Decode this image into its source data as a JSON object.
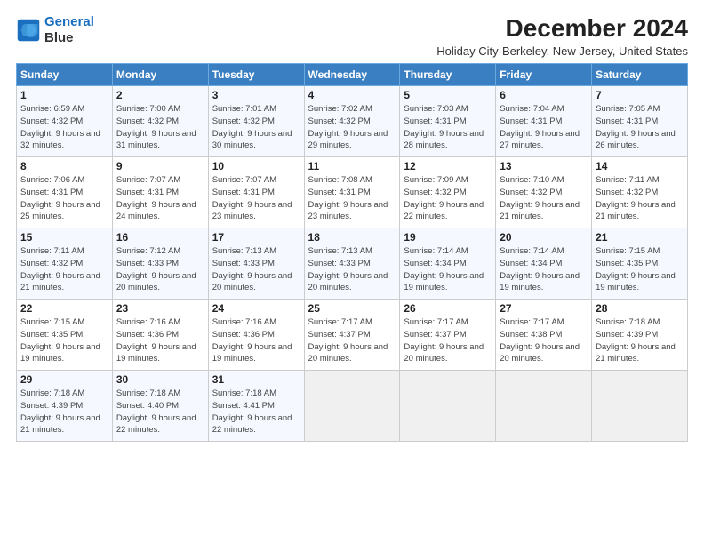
{
  "header": {
    "logo_line1": "General",
    "logo_line2": "Blue",
    "month_title": "December 2024",
    "location": "Holiday City-Berkeley, New Jersey, United States"
  },
  "weekdays": [
    "Sunday",
    "Monday",
    "Tuesday",
    "Wednesday",
    "Thursday",
    "Friday",
    "Saturday"
  ],
  "weeks": [
    [
      {
        "day": "1",
        "sunrise": "6:59 AM",
        "sunset": "4:32 PM",
        "daylight": "9 hours and 32 minutes."
      },
      {
        "day": "2",
        "sunrise": "7:00 AM",
        "sunset": "4:32 PM",
        "daylight": "9 hours and 31 minutes."
      },
      {
        "day": "3",
        "sunrise": "7:01 AM",
        "sunset": "4:32 PM",
        "daylight": "9 hours and 30 minutes."
      },
      {
        "day": "4",
        "sunrise": "7:02 AM",
        "sunset": "4:32 PM",
        "daylight": "9 hours and 29 minutes."
      },
      {
        "day": "5",
        "sunrise": "7:03 AM",
        "sunset": "4:31 PM",
        "daylight": "9 hours and 28 minutes."
      },
      {
        "day": "6",
        "sunrise": "7:04 AM",
        "sunset": "4:31 PM",
        "daylight": "9 hours and 27 minutes."
      },
      {
        "day": "7",
        "sunrise": "7:05 AM",
        "sunset": "4:31 PM",
        "daylight": "9 hours and 26 minutes."
      }
    ],
    [
      {
        "day": "8",
        "sunrise": "7:06 AM",
        "sunset": "4:31 PM",
        "daylight": "9 hours and 25 minutes."
      },
      {
        "day": "9",
        "sunrise": "7:07 AM",
        "sunset": "4:31 PM",
        "daylight": "9 hours and 24 minutes."
      },
      {
        "day": "10",
        "sunrise": "7:07 AM",
        "sunset": "4:31 PM",
        "daylight": "9 hours and 23 minutes."
      },
      {
        "day": "11",
        "sunrise": "7:08 AM",
        "sunset": "4:31 PM",
        "daylight": "9 hours and 23 minutes."
      },
      {
        "day": "12",
        "sunrise": "7:09 AM",
        "sunset": "4:32 PM",
        "daylight": "9 hours and 22 minutes."
      },
      {
        "day": "13",
        "sunrise": "7:10 AM",
        "sunset": "4:32 PM",
        "daylight": "9 hours and 21 minutes."
      },
      {
        "day": "14",
        "sunrise": "7:11 AM",
        "sunset": "4:32 PM",
        "daylight": "9 hours and 21 minutes."
      }
    ],
    [
      {
        "day": "15",
        "sunrise": "7:11 AM",
        "sunset": "4:32 PM",
        "daylight": "9 hours and 21 minutes."
      },
      {
        "day": "16",
        "sunrise": "7:12 AM",
        "sunset": "4:33 PM",
        "daylight": "9 hours and 20 minutes."
      },
      {
        "day": "17",
        "sunrise": "7:13 AM",
        "sunset": "4:33 PM",
        "daylight": "9 hours and 20 minutes."
      },
      {
        "day": "18",
        "sunrise": "7:13 AM",
        "sunset": "4:33 PM",
        "daylight": "9 hours and 20 minutes."
      },
      {
        "day": "19",
        "sunrise": "7:14 AM",
        "sunset": "4:34 PM",
        "daylight": "9 hours and 19 minutes."
      },
      {
        "day": "20",
        "sunrise": "7:14 AM",
        "sunset": "4:34 PM",
        "daylight": "9 hours and 19 minutes."
      },
      {
        "day": "21",
        "sunrise": "7:15 AM",
        "sunset": "4:35 PM",
        "daylight": "9 hours and 19 minutes."
      }
    ],
    [
      {
        "day": "22",
        "sunrise": "7:15 AM",
        "sunset": "4:35 PM",
        "daylight": "9 hours and 19 minutes."
      },
      {
        "day": "23",
        "sunrise": "7:16 AM",
        "sunset": "4:36 PM",
        "daylight": "9 hours and 19 minutes."
      },
      {
        "day": "24",
        "sunrise": "7:16 AM",
        "sunset": "4:36 PM",
        "daylight": "9 hours and 19 minutes."
      },
      {
        "day": "25",
        "sunrise": "7:17 AM",
        "sunset": "4:37 PM",
        "daylight": "9 hours and 20 minutes."
      },
      {
        "day": "26",
        "sunrise": "7:17 AM",
        "sunset": "4:37 PM",
        "daylight": "9 hours and 20 minutes."
      },
      {
        "day": "27",
        "sunrise": "7:17 AM",
        "sunset": "4:38 PM",
        "daylight": "9 hours and 20 minutes."
      },
      {
        "day": "28",
        "sunrise": "7:18 AM",
        "sunset": "4:39 PM",
        "daylight": "9 hours and 21 minutes."
      }
    ],
    [
      {
        "day": "29",
        "sunrise": "7:18 AM",
        "sunset": "4:39 PM",
        "daylight": "9 hours and 21 minutes."
      },
      {
        "day": "30",
        "sunrise": "7:18 AM",
        "sunset": "4:40 PM",
        "daylight": "9 hours and 22 minutes."
      },
      {
        "day": "31",
        "sunrise": "7:18 AM",
        "sunset": "4:41 PM",
        "daylight": "9 hours and 22 minutes."
      },
      null,
      null,
      null,
      null
    ]
  ]
}
